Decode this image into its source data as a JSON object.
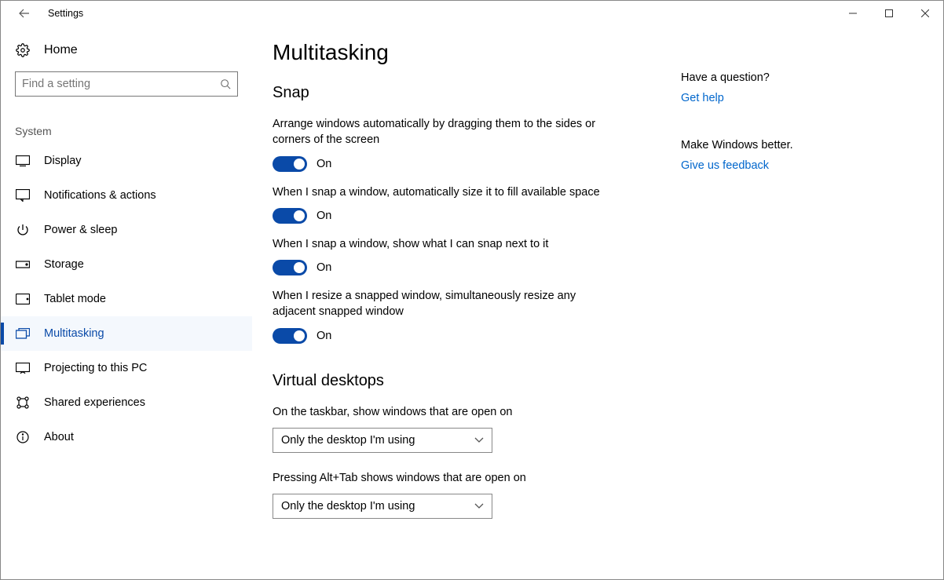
{
  "window_title": "Settings",
  "search": {
    "placeholder": "Find a setting"
  },
  "home_label": "Home",
  "sidebar_section": "System",
  "nav": [
    {
      "label": "Display"
    },
    {
      "label": "Notifications & actions"
    },
    {
      "label": "Power & sleep"
    },
    {
      "label": "Storage"
    },
    {
      "label": "Tablet mode"
    },
    {
      "label": "Multitasking"
    },
    {
      "label": "Projecting to this PC"
    },
    {
      "label": "Shared experiences"
    },
    {
      "label": "About"
    }
  ],
  "page_title": "Multitasking",
  "sections": {
    "snap": {
      "heading": "Snap",
      "items": [
        {
          "label": "Arrange windows automatically by dragging them to the sides or corners of the screen",
          "state": "On"
        },
        {
          "label": "When I snap a window, automatically size it to fill available space",
          "state": "On"
        },
        {
          "label": "When I snap a window, show what I can snap next to it",
          "state": "On"
        },
        {
          "label": "When I resize a snapped window, simultaneously resize any adjacent snapped window",
          "state": "On"
        }
      ]
    },
    "virtual_desktops": {
      "heading": "Virtual desktops",
      "items": [
        {
          "label": "On the taskbar, show windows that are open on",
          "value": "Only the desktop I'm using"
        },
        {
          "label": "Pressing Alt+Tab shows windows that are open on",
          "value": "Only the desktop I'm using"
        }
      ]
    }
  },
  "rail": {
    "q1": "Have a question?",
    "link1": "Get help",
    "q2": "Make Windows better.",
    "link2": "Give us feedback"
  }
}
